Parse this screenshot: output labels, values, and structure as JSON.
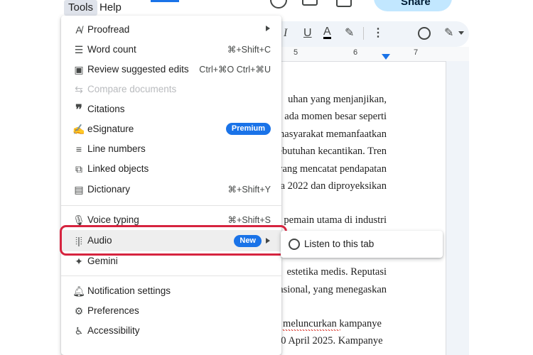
{
  "menubar": {
    "tools": "Tools",
    "help": "Help",
    "share": "Share"
  },
  "toolbar": {
    "italic": "I",
    "underline": "U",
    "text_color": "A",
    "more": "⋮"
  },
  "ruler": {
    "n5": "5",
    "n6": "6",
    "n7": "7"
  },
  "tools_menu": {
    "items": [
      {
        "label": "Proofread",
        "icon": "proofread-icon"
      },
      {
        "label": "Word count",
        "shortcut": "⌘+Shift+C",
        "icon": "word-count-icon"
      },
      {
        "label": "Review suggested edits",
        "shortcut": "Ctrl+⌘O Ctrl+⌘U",
        "icon": "review-edits-icon"
      },
      {
        "label": "Compare documents",
        "icon": "compare-icon",
        "disabled": true
      },
      {
        "label": "Citations",
        "icon": "quote-icon"
      },
      {
        "label": "eSignature",
        "badge": "Premium",
        "icon": "signature-icon"
      },
      {
        "label": "Line numbers",
        "icon": "line-numbers-icon"
      },
      {
        "label": "Linked objects",
        "icon": "linked-objects-icon"
      },
      {
        "label": "Dictionary",
        "shortcut": "⌘+Shift+Y",
        "icon": "dictionary-icon"
      },
      {
        "label": "Voice typing",
        "shortcut": "⌘+Shift+S",
        "icon": "microphone-icon"
      },
      {
        "label": "Audio",
        "badge": "New",
        "icon": "audio-icon"
      },
      {
        "label": "Gemini",
        "icon": "gemini-sparkle-icon"
      },
      {
        "label": "Notification settings",
        "icon": "bell-icon"
      },
      {
        "label": "Preferences",
        "icon": "preferences-icon"
      },
      {
        "label": "Accessibility",
        "icon": "accessibility-icon"
      }
    ]
  },
  "submenu": {
    "listen": "Listen to this tab"
  },
  "document": {
    "lines": [
      "uhan yang menjanjikan,",
      "ada momen besar seperti",
      "masyarakat memanfaatkan",
      "ebutuhan kecantikan. Tren",
      "yang mencatat pendapatan",
      "a 2022 dan diproyeksikan",
      "pemain utama di industri",
      "estetika medis. Reputasi",
      "asional, yang menegaskan",
      "c meluncurkan kampanye",
      "30 April 2025. Kampanye"
    ]
  }
}
